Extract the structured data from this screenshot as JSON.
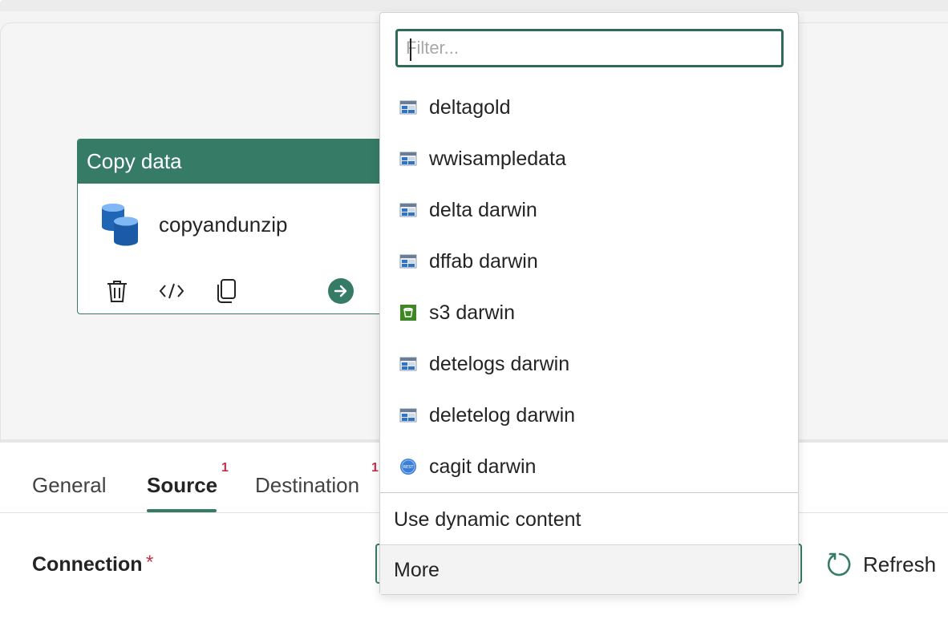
{
  "activity": {
    "header": "Copy data",
    "name": "copyandunzip",
    "tools": [
      "delete-icon",
      "code-icon",
      "copy-icon",
      "go-arrow-icon"
    ]
  },
  "tabs": [
    {
      "label": "General",
      "active": false,
      "badge": ""
    },
    {
      "label": "Source",
      "active": true,
      "badge": "1"
    },
    {
      "label": "Destination",
      "active": false,
      "badge": "1"
    }
  ],
  "connection": {
    "label": "Connection",
    "required_mark": "*",
    "refresh_label": "Refresh"
  },
  "dropdown": {
    "filter_placeholder": "Filter...",
    "items": [
      {
        "label": "deltagold",
        "icon": "table-icon"
      },
      {
        "label": "wwisampledata",
        "icon": "table-icon"
      },
      {
        "label": "delta darwin",
        "icon": "table-icon"
      },
      {
        "label": "dffab darwin",
        "icon": "table-icon"
      },
      {
        "label": "s3 darwin",
        "icon": "s3-bucket-icon"
      },
      {
        "label": "detelogs darwin",
        "icon": "table-icon"
      },
      {
        "label": "deletelog darwin",
        "icon": "table-icon"
      },
      {
        "label": "cagit darwin",
        "icon": "rest-icon"
      }
    ],
    "dynamic_content_label": "Use dynamic content",
    "more_label": "More"
  },
  "colors": {
    "accent": "#367b66",
    "required": "#c4314b"
  }
}
